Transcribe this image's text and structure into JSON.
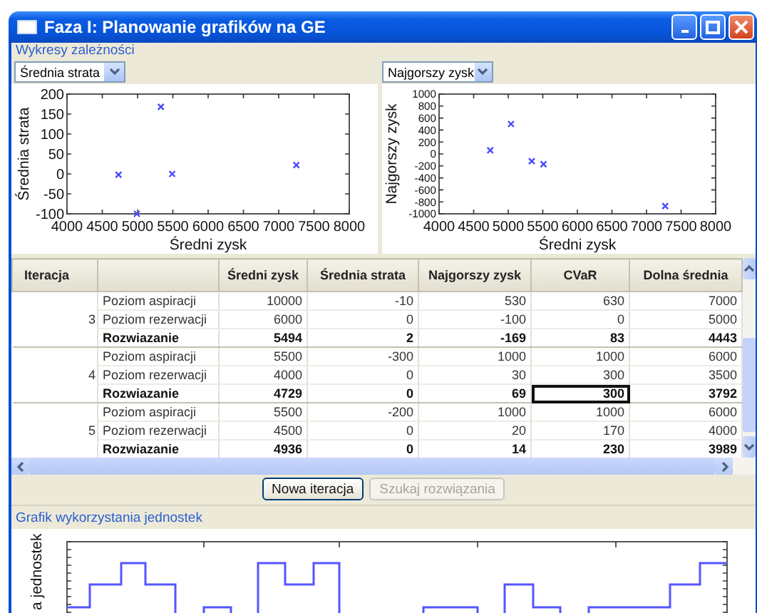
{
  "window": {
    "title": "Faza I: Planowanie grafików na GE"
  },
  "dependency_charts": {
    "legend": "Wykresy zależności",
    "panels": [
      {
        "selector": {
          "value": "Średnia strata"
        },
        "chart_data": {
          "type": "scatter",
          "xlabel": "Średni zysk",
          "ylabel": "Średnia strata",
          "x": [
            4730,
            5330,
            5490,
            7250,
            4990
          ],
          "series": [
            {
              "color": "#4a4aff",
              "values": [
                -2,
                168,
                0,
                22,
                -100
              ]
            }
          ],
          "xlim": [
            4000,
            8000
          ],
          "ylim": [
            -100,
            200
          ],
          "xticks": [
            4000,
            4500,
            5000,
            5500,
            6000,
            6500,
            7000,
            7500,
            8000
          ],
          "yticks": [
            -100,
            -50,
            0,
            50,
            100,
            150,
            200
          ]
        }
      },
      {
        "selector": {
          "value": "Najgorszy zysk"
        },
        "chart_data": {
          "type": "scatter",
          "xlabel": "Średni zysk",
          "ylabel": "Najgorszy zysk",
          "x": [
            4740,
            5040,
            5340,
            5510,
            7270
          ],
          "series": [
            {
              "color": "#4a4aff",
              "values": [
                60,
                500,
                -120,
                -170,
                -870
              ]
            }
          ],
          "xlim": [
            4000,
            8000
          ],
          "ylim": [
            -1000,
            1000
          ],
          "xticks": [
            4000,
            4500,
            5000,
            5500,
            6000,
            6500,
            7000,
            7500,
            8000
          ],
          "yticks": [
            -1000,
            -800,
            -600,
            -400,
            -200,
            0,
            200,
            400,
            600,
            800,
            1000
          ]
        }
      }
    ]
  },
  "table": {
    "columns": [
      "Iteracja",
      "Średni zysk",
      "Średnia strata",
      "Najgorszy zysk",
      "CVaR",
      "Dolna średnia"
    ],
    "iterations": [
      {
        "number": "3",
        "rows": [
          {
            "kind": "aspiration",
            "label": "Poziom aspiracji",
            "cells": [
              {
                "text": "10000",
                "focused": false
              },
              {
                "text": "-10",
                "focused": false
              },
              {
                "text": "530",
                "focused": false
              },
              {
                "text": "630",
                "focused": false
              },
              {
                "text": "7000",
                "focused": false
              }
            ]
          },
          {
            "kind": "reservation",
            "label": "Poziom rezerwacji",
            "cells": [
              {
                "text": "6000",
                "focused": false
              },
              {
                "text": "0",
                "focused": false
              },
              {
                "text": "-100",
                "focused": false
              },
              {
                "text": "0",
                "focused": false
              },
              {
                "text": "5000",
                "focused": false
              }
            ]
          },
          {
            "kind": "solution",
            "label": "Rozwiazanie",
            "cells": [
              {
                "text": "5494",
                "focused": false
              },
              {
                "text": "2",
                "focused": false
              },
              {
                "text": "-169",
                "focused": false
              },
              {
                "text": "83",
                "focused": false
              },
              {
                "text": "4443",
                "focused": false
              }
            ]
          }
        ]
      },
      {
        "number": "4",
        "rows": [
          {
            "kind": "aspiration",
            "label": "Poziom aspiracji",
            "cells": [
              {
                "text": "5500",
                "focused": false
              },
              {
                "text": "-300",
                "focused": false
              },
              {
                "text": "1000",
                "focused": false
              },
              {
                "text": "1000",
                "focused": false
              },
              {
                "text": "6000",
                "focused": false
              }
            ]
          },
          {
            "kind": "reservation",
            "label": "Poziom rezerwacji",
            "cells": [
              {
                "text": "4000",
                "focused": false
              },
              {
                "text": "0",
                "focused": false
              },
              {
                "text": "30",
                "focused": false
              },
              {
                "text": "300",
                "focused": false
              },
              {
                "text": "3500",
                "focused": false
              }
            ]
          },
          {
            "kind": "solution",
            "label": "Rozwiazanie",
            "cells": [
              {
                "text": "4729",
                "focused": false
              },
              {
                "text": "0",
                "focused": false
              },
              {
                "text": "69",
                "focused": false
              },
              {
                "text": "300",
                "focused": true
              },
              {
                "text": "3792",
                "focused": false
              }
            ]
          }
        ]
      },
      {
        "number": "5",
        "rows": [
          {
            "kind": "aspiration",
            "label": "Poziom aspiracji",
            "cells": [
              {
                "text": "5500",
                "focused": false
              },
              {
                "text": "-200",
                "focused": false
              },
              {
                "text": "1000",
                "focused": false
              },
              {
                "text": "1000",
                "focused": false
              },
              {
                "text": "6000",
                "focused": false
              }
            ]
          },
          {
            "kind": "reservation",
            "label": "Poziom rezerwacji",
            "cells": [
              {
                "text": "4500",
                "focused": false
              },
              {
                "text": "0",
                "focused": false
              },
              {
                "text": "20",
                "focused": false
              },
              {
                "text": "170",
                "focused": false
              },
              {
                "text": "4000",
                "focused": false
              }
            ]
          },
          {
            "kind": "solution",
            "label": "Rozwiazanie",
            "cells": [
              {
                "text": "4936",
                "focused": false
              },
              {
                "text": "0",
                "focused": false
              },
              {
                "text": "14",
                "focused": false
              },
              {
                "text": "230",
                "focused": false
              },
              {
                "text": "3989",
                "focused": false
              }
            ]
          }
        ]
      }
    ]
  },
  "buttons": [
    {
      "label": "Nowa iteracja",
      "disabled": false
    },
    {
      "label": "Szukaj rozwiązania",
      "disabled": true
    }
  ],
  "usage_chart": {
    "legend": "Grafik wykorzystania jednostek",
    "ylabel": "a jednostek"
  }
}
